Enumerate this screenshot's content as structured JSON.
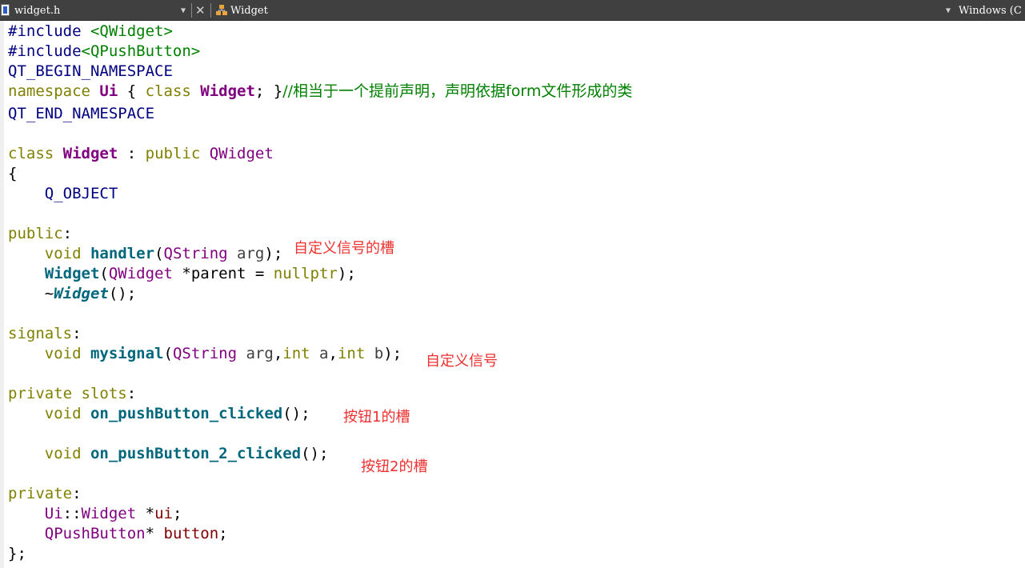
{
  "toolbar": {
    "file_name": "widget.h",
    "class_name": "Widget",
    "platform": "Windows (C"
  },
  "code": {
    "l1": {
      "a": "#include ",
      "b": "<QWidget>"
    },
    "l2": {
      "a": "#include",
      "b": "<QPushButton>"
    },
    "l3": {
      "a": "QT_BEGIN_NAMESPACE"
    },
    "l4": {
      "a": "namespace",
      "b": " ",
      "c": "Ui",
      "d": " { ",
      "e": "class",
      "f": " ",
      "g": "Widget",
      "h": "; }",
      "i": "//相当于一个提前声明，声明依据form文件形成的类"
    },
    "l5": {
      "a": "QT_END_NAMESPACE"
    },
    "l6": {
      "a": "class",
      "b": " ",
      "c": "Widget",
      "d": " : ",
      "e": "public",
      "f": " ",
      "g": "QWidget"
    },
    "l7": {
      "a": "{"
    },
    "l8": {
      "a": "    ",
      "b": "Q_OBJECT"
    },
    "l9": {
      "a": "public",
      "b": ":"
    },
    "l10": {
      "a": "    ",
      "b": "void",
      "c": " ",
      "d": "handler",
      "e": "(",
      "f": "QString",
      "g": " ",
      "h": "arg",
      "i": ");"
    },
    "l11": {
      "a": "    ",
      "b": "Widget",
      "c": "(",
      "d": "QWidget",
      "e": " *",
      "f": "parent",
      "g": " = ",
      "h": "nullptr",
      "i": ");"
    },
    "l12": {
      "a": "    ~",
      "b": "Widget",
      "c": "();"
    },
    "l13": {
      "a": "signals",
      "b": ":"
    },
    "l14": {
      "a": "    ",
      "b": "void",
      "c": " ",
      "d": "mysignal",
      "e": "(",
      "f": "QString",
      "g": " ",
      "h": "arg",
      "i": ",",
      "j": "int",
      "k": " ",
      "l": "a",
      "m": ",",
      "n": "int",
      "o": " ",
      "p": "b",
      "q": ");"
    },
    "l15": {
      "a": "private",
      "b": " ",
      "c": "slots",
      "d": ":"
    },
    "l16": {
      "a": "    ",
      "b": "void",
      "c": " ",
      "d": "on_pushButton_clicked",
      "e": "();"
    },
    "l17": {
      "a": "    ",
      "b": "void",
      "c": " ",
      "d": "on_pushButton_2_clicked",
      "e": "();"
    },
    "l18": {
      "a": "private",
      "b": ":"
    },
    "l19": {
      "a": "    ",
      "b": "Ui",
      "c": "::",
      "d": "Widget",
      "e": " *",
      "f": "ui",
      "g": ";"
    },
    "l20": {
      "a": "    ",
      "b": "QPushButton",
      "c": "* ",
      "d": "button",
      "e": ";"
    },
    "l21": {
      "a": "};"
    }
  },
  "annotations": {
    "handler_note": "自定义信号的槽",
    "signal_note": "自定义信号",
    "button1_note": "按钮1的槽",
    "button2_note": "按钮2的槽"
  },
  "colors": {
    "toolbar_bg": "#404040",
    "preprocessor": "#000080",
    "string": "#008000",
    "keyword": "#808000",
    "type": "#800080",
    "function": "#00677c",
    "comment": "#008000",
    "annotation": "#ee3030"
  },
  "icons": [
    "header-file-icon",
    "dropdown-caret-icon",
    "close-icon",
    "class-icon"
  ]
}
